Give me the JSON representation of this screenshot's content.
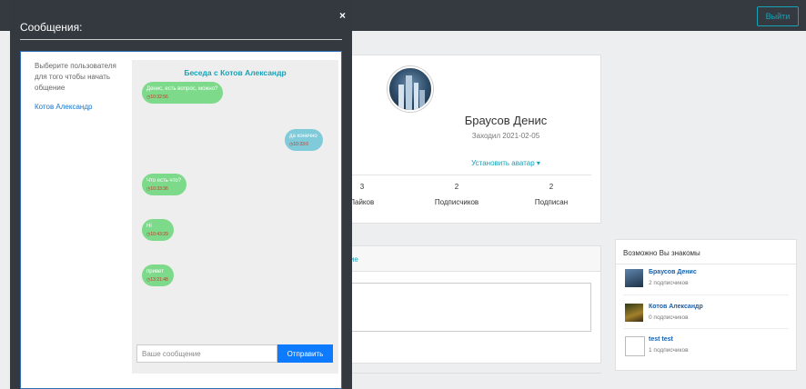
{
  "topbar": {
    "logout_label": "Выйти"
  },
  "profile": {
    "name": "Браусов Денис",
    "visited": "Заходил 2021-02-05",
    "set_avatar": "Установить аватар ▾",
    "stats": [
      {
        "num": "3",
        "label": "Лайков",
        "visible_label": "Лайков"
      },
      {
        "num": "2",
        "label": "Подписчиков"
      },
      {
        "num": "2",
        "label": "Подписан"
      }
    ]
  },
  "post": {
    "tab_label": "ение"
  },
  "friends": {
    "title": "Возможно Вы знакомы",
    "items": [
      {
        "name": "Браусов Денис",
        "sub": "2 подписчиков"
      },
      {
        "name": "Котов Александр",
        "sub": "0 подписчиков"
      },
      {
        "name": "test test",
        "sub": "1 подписчиков"
      }
    ]
  },
  "modal": {
    "title": "Сообщения:",
    "close": "×",
    "hint": "Выберите пользователя для того чтобы начать общение",
    "contacts": [
      "Котов Александр"
    ],
    "chat": {
      "title": "Беседа с Котов Александр",
      "messages": [
        {
          "dir": "in",
          "text": "Денис, есть вопрос, можно?",
          "time": "10:32:56"
        },
        {
          "dir": "out",
          "text": "да конечно",
          "time": "10:33:0"
        },
        {
          "dir": "in",
          "text": "Что есть что?",
          "time": "10:33:36"
        },
        {
          "dir": "in",
          "text": "Hi",
          "time": "10:43:29"
        },
        {
          "dir": "in",
          "text": "привет",
          "time": "13:21:48"
        }
      ],
      "input_placeholder": "Ваше сообщение",
      "send_label": "Отправить"
    }
  },
  "colors": {
    "accent": "#17a2b8",
    "in_bubble": "#7cda8a",
    "out_bubble": "#7fcbd9",
    "send": "#0d7bff",
    "modal_bg": "#33393f"
  }
}
